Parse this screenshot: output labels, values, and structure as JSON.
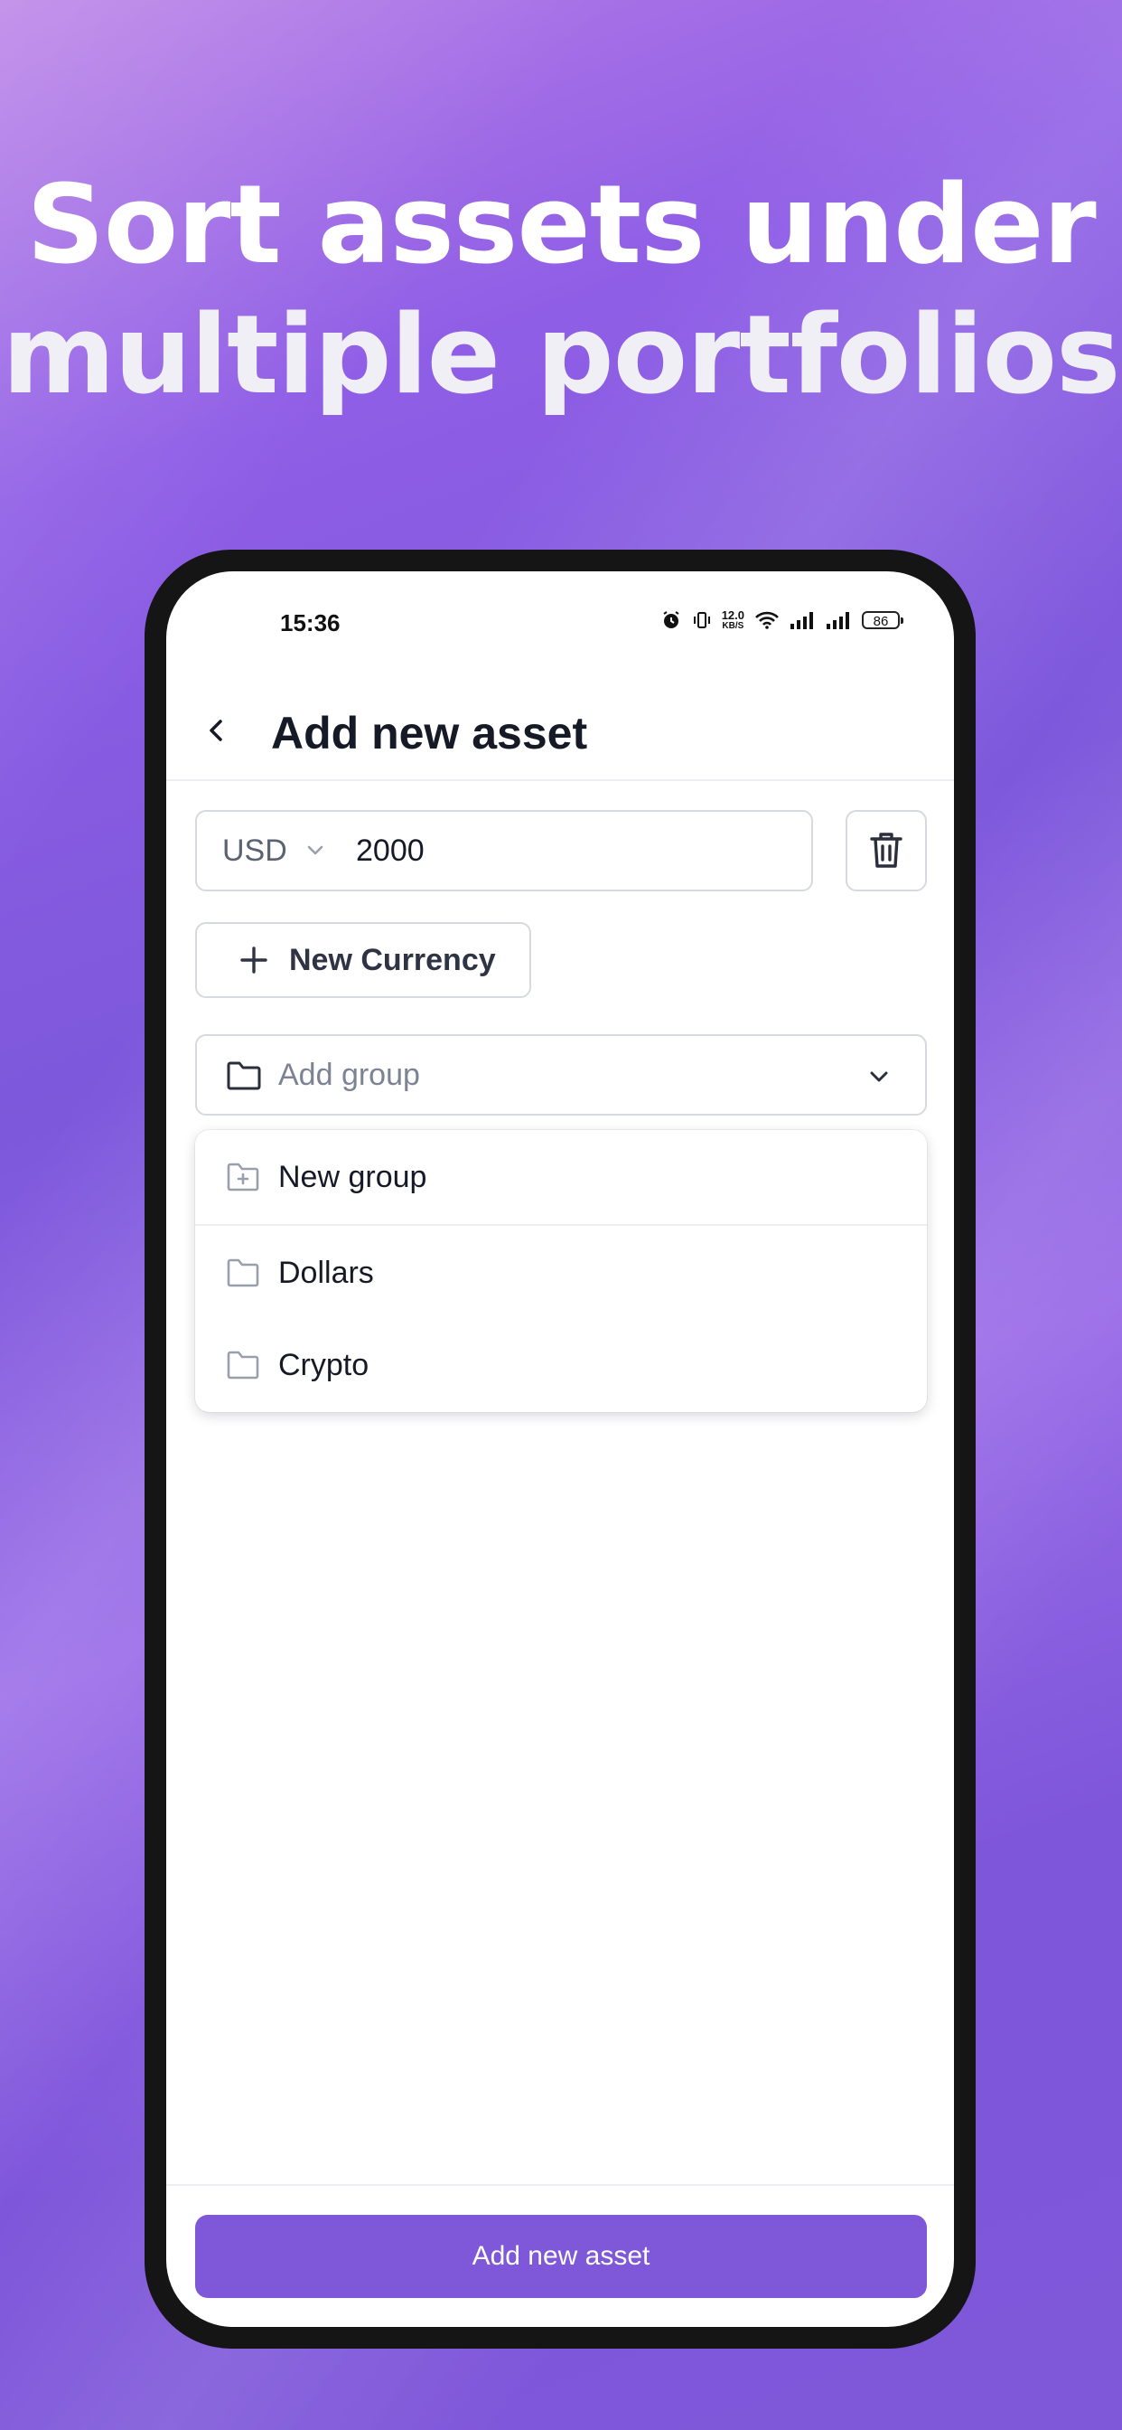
{
  "headline": {
    "line1": "Sort assets under",
    "line2": "multiple portfolios"
  },
  "status_bar": {
    "time": "15:36",
    "net_speed_value": "12.0",
    "net_speed_unit": "KB/S",
    "battery": "86",
    "icons": [
      "alarm-icon",
      "vibrate-icon",
      "wifi-icon",
      "signal-icon",
      "signal-icon",
      "battery-icon"
    ]
  },
  "header": {
    "title": "Add new asset",
    "back_icon": "chevron-left-icon"
  },
  "amount": {
    "currency": "USD",
    "value": "2000"
  },
  "new_currency_label": "New Currency",
  "group_select": {
    "placeholder": "Add group"
  },
  "dropdown": {
    "items": [
      {
        "label": "New group",
        "icon": "folder-plus-icon"
      },
      {
        "label": "Dollars",
        "icon": "folder-icon"
      },
      {
        "label": "Crypto",
        "icon": "folder-icon"
      }
    ]
  },
  "footer": {
    "submit_label": "Add new asset"
  },
  "colors": {
    "accent": "#7f57d9",
    "text_primary": "#161a26",
    "border": "#d6d9df"
  }
}
